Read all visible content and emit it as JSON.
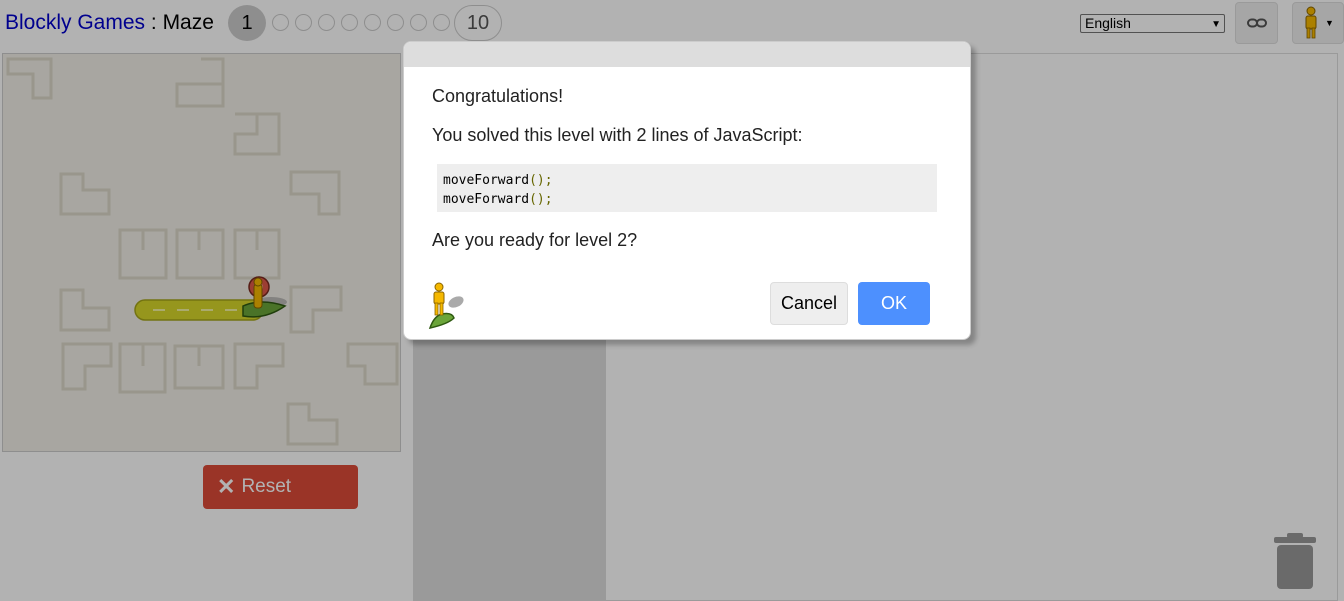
{
  "header": {
    "app_link": "Blockly Games",
    "separator": " : ",
    "game_name": "Maze",
    "current_level": "1",
    "last_level": "10",
    "language": "English"
  },
  "maze_controls": {
    "reset_label": "Reset"
  },
  "dialog": {
    "congrats": "Congratulations!",
    "summary": "You solved this level with 2 lines of JavaScript:",
    "code_lines": [
      "moveForward",
      "moveForward"
    ],
    "code_suffix": "();",
    "next_prompt": "Are you ready for level 2?",
    "cancel_label": "Cancel",
    "ok_label": "OK"
  },
  "icons": {
    "link": "link-icon",
    "pegman": "pegman-icon",
    "reset": "close-x-icon",
    "trash": "trash-icon"
  },
  "colors": {
    "accent_blue": "#4d90fe",
    "reset_red": "#dd4b39",
    "link_blue": "#0000cc",
    "path_yellow": "#d7d72a",
    "goal_red": "#e05a4a"
  }
}
